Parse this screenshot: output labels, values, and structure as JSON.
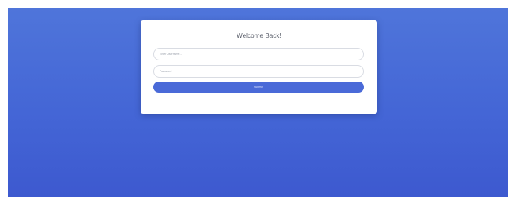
{
  "login": {
    "title": "Welcome Back!",
    "username": {
      "placeholder": "Enter Username...",
      "value": ""
    },
    "password": {
      "placeholder": "Password",
      "value": ""
    },
    "submit_label": "submit"
  },
  "colors": {
    "background_gradient": [
      "#4f75da",
      "#3d59cf"
    ],
    "card": "#ffffff",
    "accent": "#4a6ad8"
  }
}
